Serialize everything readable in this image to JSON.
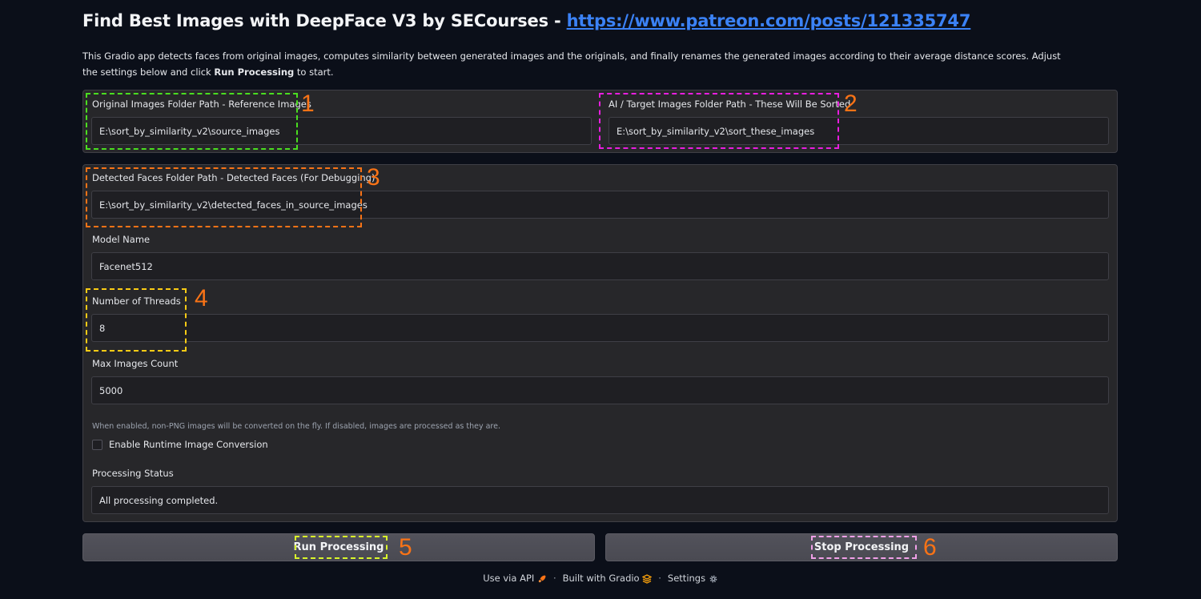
{
  "header": {
    "title": "Find Best Images with DeepFace V3 by SECourses - ",
    "link_text": "https://www.patreon.com/posts/121335747",
    "description_part1": "This Gradio app detects faces from original images, computes similarity between generated images and the originals, and finally renames the generated images according to their average distance scores. Adjust the settings below and click ",
    "description_bold": "Run Processing",
    "description_part2": " to start."
  },
  "fields": {
    "original_folder": {
      "label": "Original Images Folder Path - Reference Images",
      "value": "E:\\sort_by_similarity_v2\\source_images"
    },
    "target_folder": {
      "label": "AI / Target Images Folder Path - These Will Be Sorted",
      "value": "E:\\sort_by_similarity_v2\\sort_these_images"
    },
    "detected_folder": {
      "label": "Detected Faces Folder Path - Detected Faces (For Debugging)",
      "value": "E:\\sort_by_similarity_v2\\detected_faces_in_source_images"
    },
    "model_name": {
      "label": "Model Name",
      "value": "Facenet512"
    },
    "threads": {
      "label": "Number of Threads",
      "value": "8"
    },
    "max_images": {
      "label": "Max Images Count",
      "value": "5000"
    },
    "conversion": {
      "info": "When enabled, non-PNG images will be converted on the fly. If disabled, images are processed as they are.",
      "label": "Enable Runtime Image Conversion",
      "checked": false
    },
    "status": {
      "label": "Processing Status",
      "value": "All processing completed."
    }
  },
  "buttons": {
    "run_label": "Run Processing",
    "stop_label": "Stop Processing"
  },
  "annotations": {
    "n1": "1",
    "n2": "2",
    "n3": "3",
    "n4": "4",
    "n5": "5",
    "n6": "6",
    "colors": {
      "green": "#4ade20",
      "magenta": "#e91ee0",
      "orange": "#f97316",
      "yellow": "#facc15",
      "lime": "#d9f52a",
      "pink": "#f0a0e8"
    }
  },
  "footer": {
    "api": "Use via API",
    "gradio": "Built with Gradio",
    "settings": "Settings",
    "separator": "·"
  },
  "icons": {
    "api": "rocket-icon",
    "gradio": "gradio-logo-icon",
    "settings": "gear-icon"
  }
}
